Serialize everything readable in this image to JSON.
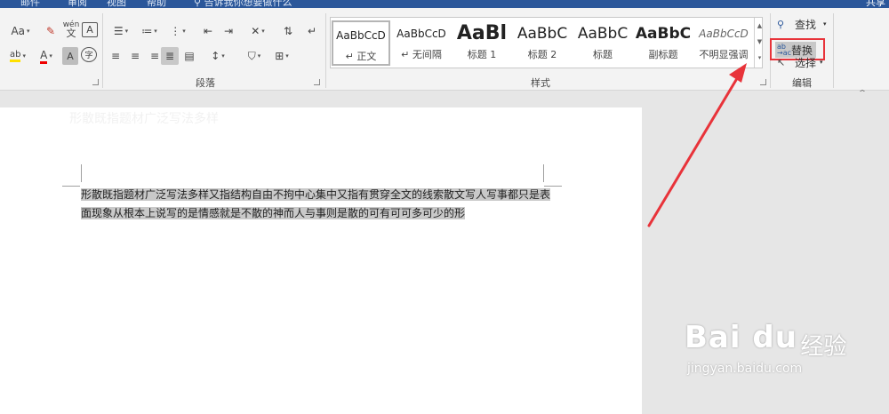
{
  "titlebar": {
    "tabs": [
      "邮件",
      "审阅",
      "视图",
      "帮助"
    ],
    "tell_me": "告诉我你想要做什么",
    "share": "共享"
  },
  "ribbon": {
    "font_group": {
      "font_size_btn": "Aa",
      "phonetic": "wén",
      "border_char": "A",
      "highlight": "ab",
      "font_color": "A",
      "shade_char": "A",
      "enclose_char": "字"
    },
    "paragraph_group": {
      "label": "段落"
    },
    "styles_group": {
      "label": "样式",
      "items": [
        {
          "preview": "AaBbCcD",
          "name": "正文",
          "marker": "↵"
        },
        {
          "preview": "AaBbCcD",
          "name": "无间隔",
          "marker": "↵"
        },
        {
          "preview": "AaBl",
          "name": "标题 1",
          "marker": ""
        },
        {
          "preview": "AaBbC",
          "name": "标题 2",
          "marker": ""
        },
        {
          "preview": "AaBbC",
          "name": "标题",
          "marker": ""
        },
        {
          "preview": "AaBbC",
          "name": "副标题",
          "marker": ""
        },
        {
          "preview": "AaBbCcD",
          "name": "不明显强调",
          "marker": ""
        }
      ]
    },
    "editing_group": {
      "label": "编辑",
      "find": "查找",
      "replace": "替换",
      "select": "选择"
    }
  },
  "document": {
    "body_text": "形散既指题材广泛写法多样又指结构自由不拘中心集中又指有贯穿全文的线索散文写人写事都只是表面现象从根本上说写的是情感就是不散的神而人与事则是散的可有可可多可少的形",
    "faded_text": "形散既指题材广泛写法多样"
  },
  "annotation": {
    "highlight_color": "#e8333a",
    "arrow_color": "#e8333a"
  },
  "watermark": {
    "logo": "Bai du",
    "brand_cn": "经验",
    "url": "jingyan.baidu.com"
  }
}
